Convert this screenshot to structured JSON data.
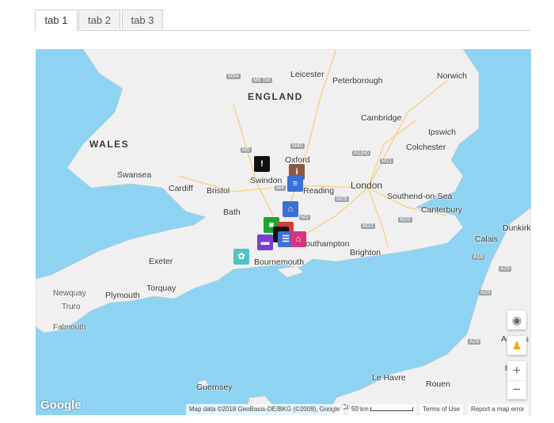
{
  "tabs": [
    "tab 1",
    "tab 2",
    "tab 3"
  ],
  "map": {
    "regions": [
      "ENGLAND",
      "WALES"
    ],
    "cities": [
      "Leicester",
      "Peterborough",
      "Norwich",
      "Cambridge",
      "Ipswich",
      "Colchester",
      "Oxford",
      "Swindon",
      "London",
      "Southend-on-Sea",
      "Swansea",
      "Cardiff",
      "Bristol",
      "Reading",
      "Bath",
      "Canterbury",
      "Brighton",
      "Exeter",
      "Torquay",
      "Plymouth",
      "Newquay",
      "Truro",
      "Falmouth",
      "Guernsey",
      "Le Havre",
      "Rouen",
      "Calais",
      "Dunkirk",
      "Amiens",
      "Caen",
      "Bournemouth",
      "Southampton"
    ],
    "roads": [
      "M54",
      "M6 Toll",
      "M5",
      "M40",
      "A1(M)",
      "M11",
      "M4",
      "M25",
      "M3",
      "M20",
      "M23",
      "A16",
      "A26",
      "A29",
      "A28",
      "A1"
    ],
    "markers": [
      {
        "name": "warning-marker",
        "color": "#111111",
        "glyph": "!"
      },
      {
        "name": "info-marker",
        "color": "#8a5a44",
        "glyph": "i"
      },
      {
        "name": "document-marker",
        "color": "#3b6fd6",
        "glyph": "≡"
      },
      {
        "name": "museum-marker",
        "color": "#3b6fd6",
        "glyph": "⌂"
      },
      {
        "name": "bus-marker",
        "color": "#1aa82a",
        "glyph": "■"
      },
      {
        "name": "red-marker",
        "color": "#d83a3a",
        "glyph": "●"
      },
      {
        "name": "black-marker",
        "color": "#111111",
        "glyph": "■"
      },
      {
        "name": "bed-marker",
        "color": "#7a3fd0",
        "glyph": "▬"
      },
      {
        "name": "phone-marker",
        "color": "#3b6fd6",
        "glyph": "☰"
      },
      {
        "name": "home-marker",
        "color": "#d6357e",
        "glyph": "⌂"
      },
      {
        "name": "flower-marker",
        "color": "#4fc4c4",
        "glyph": "✿"
      }
    ],
    "attribution": "Map data ©2018 GeoBasis-DE/BKG (©2009), Google",
    "scale": "50 km",
    "terms": "Terms of Use",
    "report": "Report a map error",
    "logo": "Google",
    "zoom_in": "+",
    "zoom_out": "−"
  }
}
